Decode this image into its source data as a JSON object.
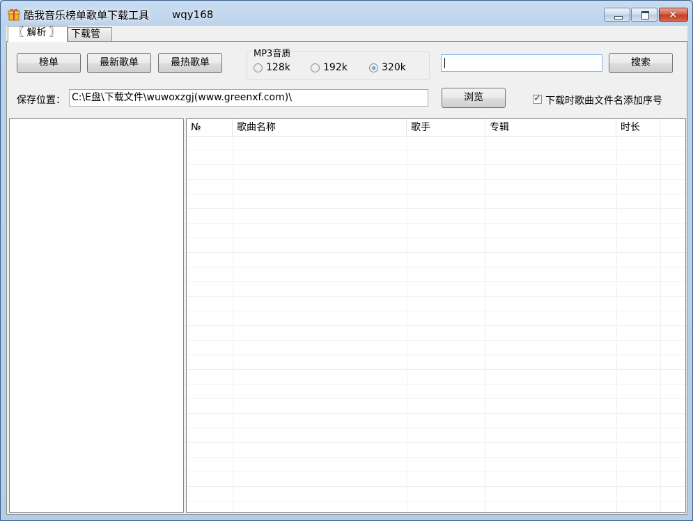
{
  "window": {
    "title": "酷我音乐榜单歌单下载工具",
    "user": "wqy168",
    "close_glyph": "✕"
  },
  "tabs": [
    {
      "label": "〖 解析 〗",
      "active": true
    },
    {
      "label": "下载管理",
      "active": false
    }
  ],
  "toolbar": {
    "chart_button": "榜单",
    "newest_button": "最新歌单",
    "hottest_button": "最热歌单",
    "search_button": "搜索",
    "browse_button": "浏览"
  },
  "quality": {
    "legend": "MP3音质",
    "options": [
      {
        "label": "128k",
        "selected": false
      },
      {
        "label": "192k",
        "selected": false
      },
      {
        "label": "320k",
        "selected": true
      }
    ]
  },
  "search": {
    "value": ""
  },
  "save": {
    "label": "保存位置：",
    "path": "C:\\E盘\\下载文件\\wuwoxzgj(www.greenxf.com)\\"
  },
  "option": {
    "add_sequence_label": "下载时歌曲文件名添加序号",
    "add_sequence_checked": true,
    "check_glyph": "✓"
  },
  "song_list": {
    "columns": [
      "№",
      "歌曲名称",
      "歌手",
      "专辑",
      "时长"
    ],
    "rows": []
  }
}
